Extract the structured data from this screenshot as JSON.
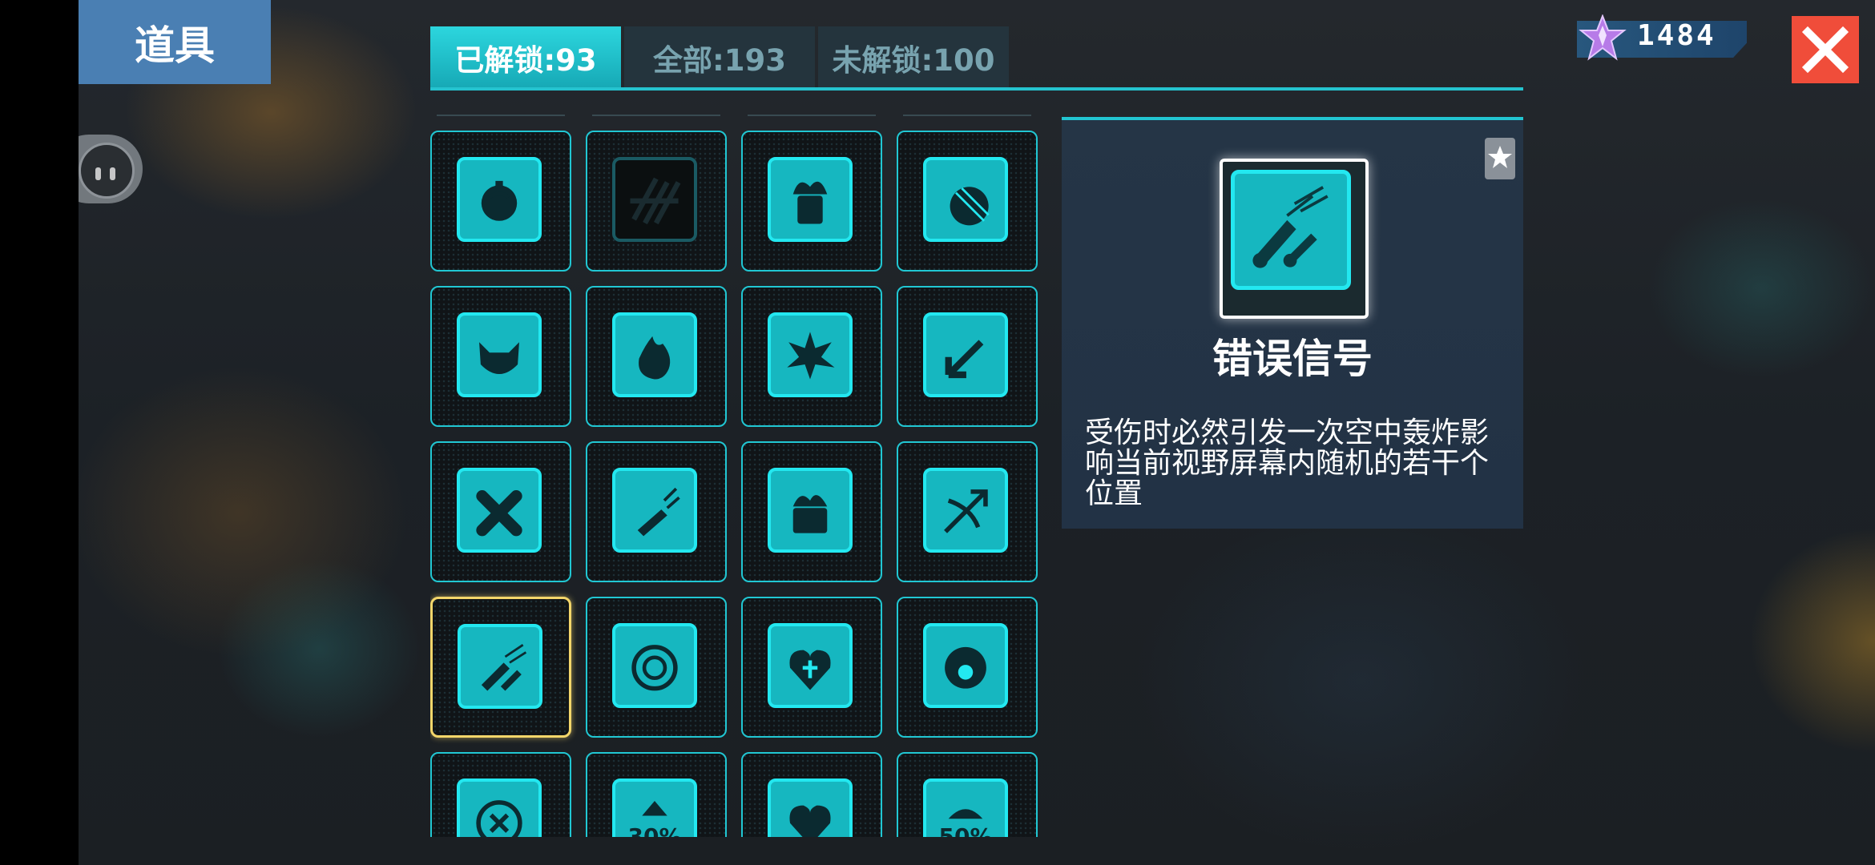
{
  "header": {
    "title": "道具"
  },
  "tabs": [
    {
      "label": "已解锁:93",
      "active": true
    },
    {
      "label": "全部:193",
      "active": false
    },
    {
      "label": "未解锁:100",
      "active": false
    }
  ],
  "currency": {
    "value": "1484",
    "icon": "purple-star-gem-icon"
  },
  "colors": {
    "accent": "#23e8f0",
    "selected": "#f3d66a",
    "close": "#f04d3a",
    "header": "#4a7fb3"
  },
  "items": [
    {
      "icon": "potion-bomb-icon"
    },
    {
      "icon": "broken-grid-icon",
      "dark": true
    },
    {
      "icon": "fire-backpack-icon"
    },
    {
      "icon": "striped-ball-icon"
    },
    {
      "icon": "horned-face-icon"
    },
    {
      "icon": "fireball-icon"
    },
    {
      "icon": "explosion-icon"
    },
    {
      "icon": "arrow-down-left-icon"
    },
    {
      "icon": "bone-cross-icon"
    },
    {
      "icon": "rocket-flare-icon"
    },
    {
      "icon": "burning-chest-icon"
    },
    {
      "icon": "crossbow-icon"
    },
    {
      "icon": "missiles-icon",
      "selected": true
    },
    {
      "icon": "target-clock-icon"
    },
    {
      "icon": "heart-cross-icon"
    },
    {
      "icon": "shield-ring-icon"
    },
    {
      "icon": "circle-x-icon"
    },
    {
      "icon": "arrow-up-percent-icon",
      "text": "30%"
    },
    {
      "icon": "broken-heart-icon"
    },
    {
      "icon": "dome-percent-icon",
      "text": "50%"
    }
  ],
  "detail": {
    "name": "错误信号",
    "description": "受伤时必然引发一次空中轰炸影响当前视野屏幕内随机的若干个位置",
    "icon": "missiles-icon"
  }
}
